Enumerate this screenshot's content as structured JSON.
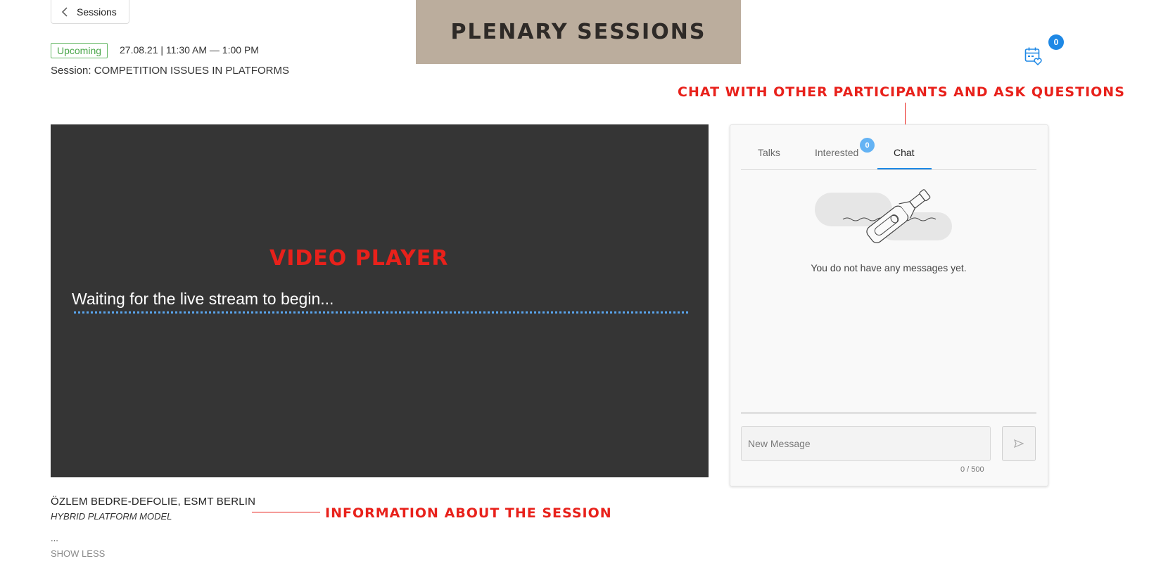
{
  "header": {
    "back_label": "Sessions",
    "banner_title": "PLENARY SESSIONS",
    "status": "Upcoming",
    "datetime": "27.08.21 | 11:30 AM — 1:00 PM",
    "session_title": "Session: COMPETITION ISSUES IN PLATFORMS",
    "calendar_count": "0"
  },
  "annotations": {
    "chat": "CHAT WITH OTHER PARTICIPANTS AND ASK QUESTIONS",
    "video": "VIDEO PLAYER",
    "info": "INFORMATION ABOUT THE SESSION"
  },
  "video": {
    "waiting_text": "Waiting for the live stream to begin..."
  },
  "session_info": {
    "speaker": "ÖZLEM BEDRE-DEFOLIE, ESMT BERLIN",
    "subtitle": "HYBRID PLATFORM MODEL",
    "ellipsis": "...",
    "show_less": "SHOW LESS"
  },
  "panel": {
    "tabs": [
      {
        "label": "Talks"
      },
      {
        "label": "Interested",
        "badge": "0"
      },
      {
        "label": "Chat",
        "active": true
      }
    ],
    "empty_message": "You do not have any messages yet.",
    "input_placeholder": "New Message",
    "counter": "0 / 500"
  },
  "icons": {
    "back": "chevron-left-icon",
    "calendar": "calendar-heart-icon",
    "send": "send-icon",
    "empty": "message-bottle-illustration"
  },
  "colors": {
    "banner": "#bbad9d",
    "accent": "#1e88e5",
    "annotation": "#e8211b",
    "status": "#4aa64a",
    "video_bg": "#353535"
  }
}
